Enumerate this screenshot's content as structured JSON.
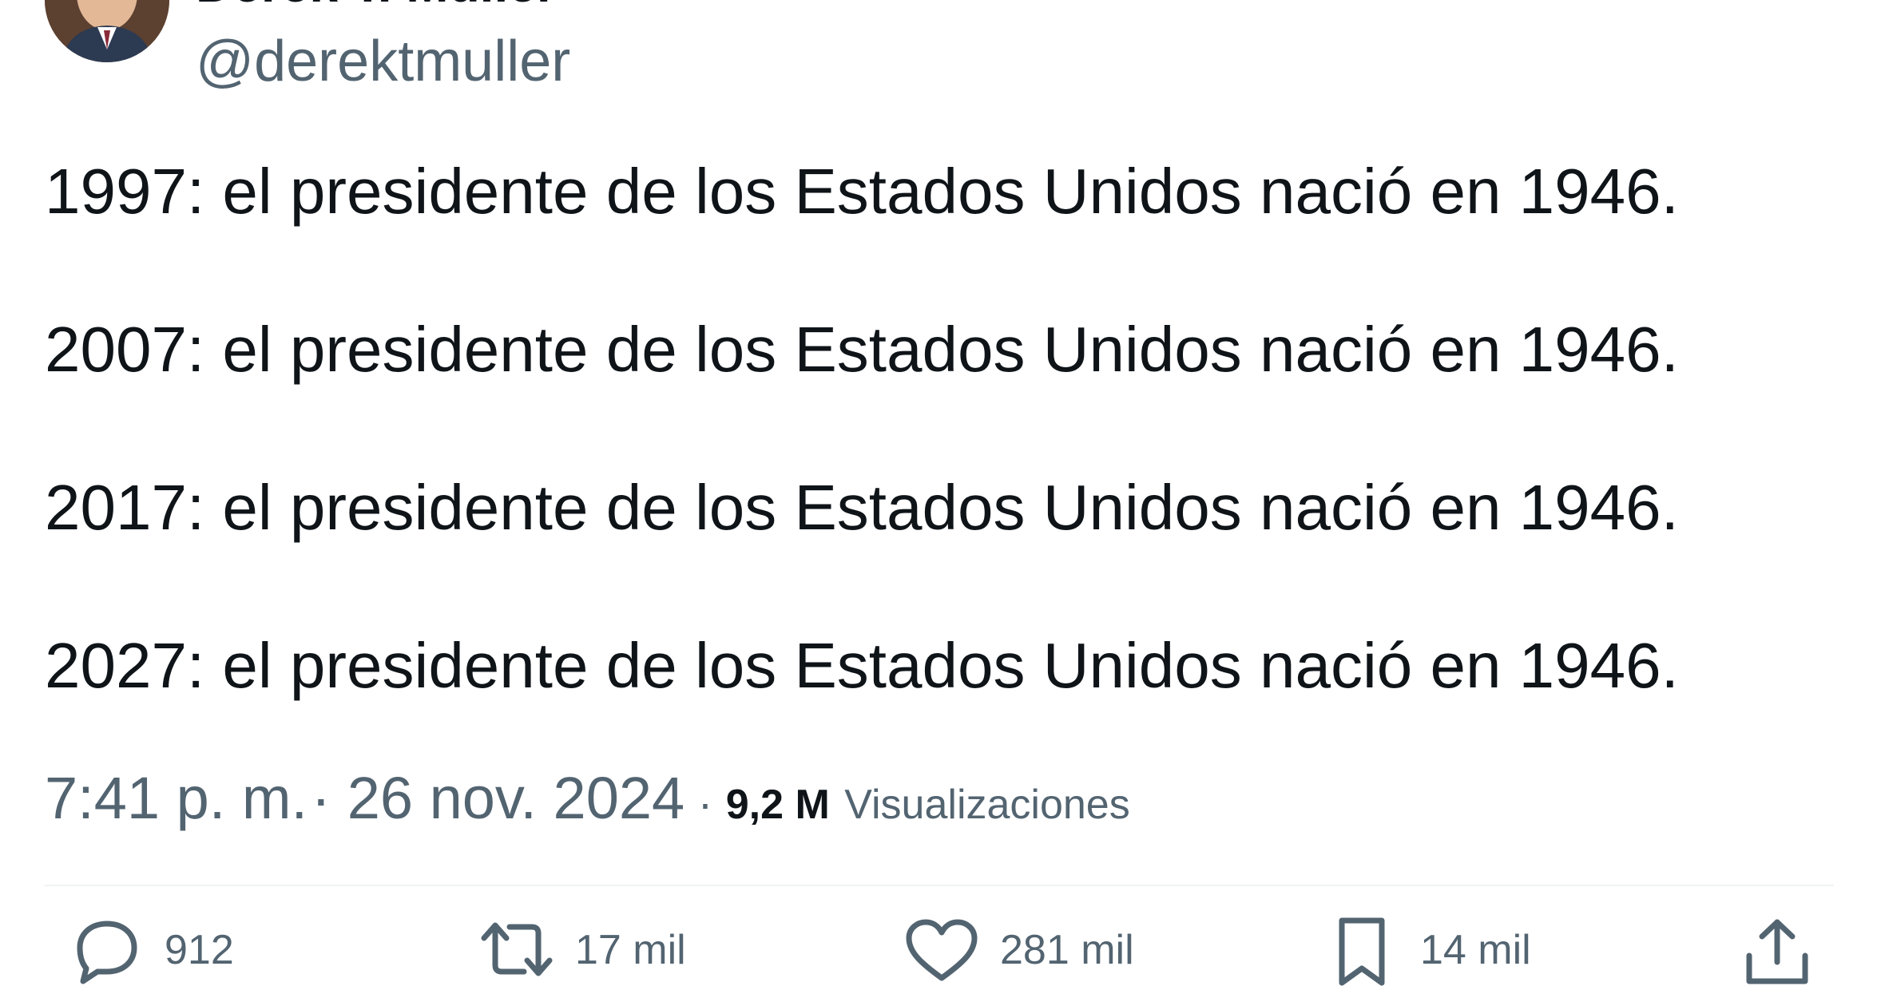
{
  "author": {
    "name": "Derek T. Muller",
    "handle": "@derektmuller"
  },
  "tweet": {
    "lines": [
      "1997: el presidente de los Estados Unidos nació en 1946.",
      "2007: el presidente de los Estados Unidos nació en 1946.",
      "2017: el presidente de los Estados Unidos nació en 1946.",
      "2027: el presidente de los Estados Unidos nació en 1946."
    ]
  },
  "meta": {
    "time": "7:41 p. m.",
    "separator": "·",
    "date": "26 nov. 2024",
    "views_count": "9,2 M",
    "views_label": "Visualizaciones"
  },
  "actions": {
    "replies": "912",
    "retweets": "17 mil",
    "likes": "281 mil",
    "bookmarks": "14 mil"
  },
  "icons": {
    "reply": "reply-icon",
    "retweet": "retweet-icon",
    "like": "heart-icon",
    "bookmark": "bookmark-icon",
    "share": "share-icon"
  },
  "colors": {
    "text": "#0f1419",
    "secondary": "#536471",
    "divider": "#eff3f4"
  }
}
